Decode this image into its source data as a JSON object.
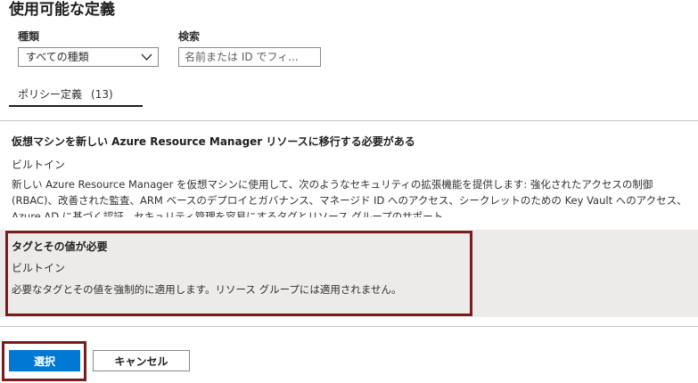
{
  "header": {
    "title": "使用可能な定義"
  },
  "filters": {
    "type_label": "種類",
    "type_selected": "すべての種類",
    "search_label": "検索",
    "search_placeholder": "名前または ID でフィ..."
  },
  "tabs": [
    {
      "label": "ポリシー定義",
      "count": "(13)"
    }
  ],
  "definitions": [
    {
      "title": "仮想マシンを新しい Azure Resource Manager リソースに移行する必要がある",
      "type": "ビルトイン",
      "description": "新しい Azure Resource Manager を仮想マシンに使用して、次のようなセキュリティの拡張機能を提供します: 強化されたアクセスの制御 (RBAC)、改善された監査、ARM ベースのデプロイとガバナンス、マネージド ID へのアクセス、シークレットのための Key Vault へのアクセス、Azure AD に基づく認証、セキュリティ管理を容易にするタグとリソース グループのサポート"
    },
    {
      "title": "タグとその値が必要",
      "type": "ビルトイン",
      "description": "必要なタグとその値を強制的に適用します。リソース グループには適用されません。"
    }
  ],
  "footer": {
    "select_label": "選択",
    "cancel_label": "キャンセル"
  },
  "colors": {
    "primary": "#0078d4",
    "highlight_border": "#7b1c1c",
    "selected_row_bg": "#edebe9"
  }
}
